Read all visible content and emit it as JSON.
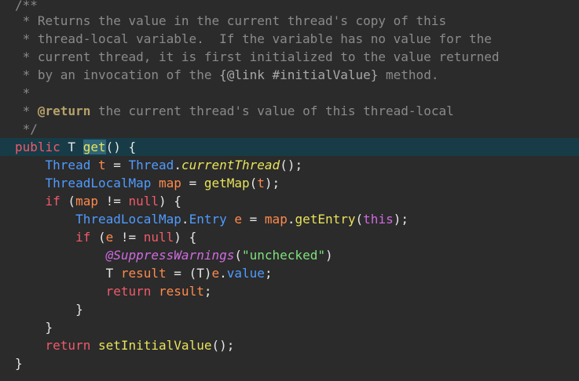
{
  "lines": [
    {
      "tokens": [
        {
          "t": "/**",
          "c": "c-comment"
        }
      ]
    },
    {
      "tokens": [
        {
          "t": " * Returns the value in the current thread's copy of this",
          "c": "c-comment"
        }
      ]
    },
    {
      "tokens": [
        {
          "t": " * thread-local variable.  If the variable has no value for the",
          "c": "c-comment"
        }
      ]
    },
    {
      "tokens": [
        {
          "t": " * current thread, it is first initialized to the value returned",
          "c": "c-comment"
        }
      ]
    },
    {
      "tokens": [
        {
          "t": " * by an invocation of the ",
          "c": "c-comment"
        },
        {
          "t": "{@link #initialValue}",
          "c": "c-link"
        },
        {
          "t": " method.",
          "c": "c-comment"
        }
      ]
    },
    {
      "tokens": [
        {
          "t": " *",
          "c": "c-comment"
        }
      ]
    },
    {
      "tokens": [
        {
          "t": " * ",
          "c": "c-comment"
        },
        {
          "t": "@return",
          "c": "c-doctag"
        },
        {
          "t": " the current thread's value of this thread-local",
          "c": "c-comment"
        }
      ]
    },
    {
      "tokens": [
        {
          "t": " */",
          "c": "c-comment"
        }
      ]
    },
    {
      "current": true,
      "tokens": [
        {
          "t": "public",
          "c": "c-keyword"
        },
        {
          "t": " T ",
          "c": "c-plain"
        },
        {
          "t": "get",
          "c": "c-method hl-word"
        },
        {
          "t": "() {",
          "c": "c-plain"
        }
      ]
    },
    {
      "tokens": [
        {
          "t": "    ",
          "c": "c-plain"
        },
        {
          "t": "Thread",
          "c": "c-type"
        },
        {
          "t": " ",
          "c": "c-plain"
        },
        {
          "t": "t",
          "c": "c-var"
        },
        {
          "t": " = ",
          "c": "c-plain"
        },
        {
          "t": "Thread",
          "c": "c-type"
        },
        {
          "t": ".",
          "c": "c-plain"
        },
        {
          "t": "currentThread",
          "c": "c-italic-method"
        },
        {
          "t": "();",
          "c": "c-plain"
        }
      ]
    },
    {
      "tokens": [
        {
          "t": "    ",
          "c": "c-plain"
        },
        {
          "t": "ThreadLocalMap",
          "c": "c-type"
        },
        {
          "t": " ",
          "c": "c-plain"
        },
        {
          "t": "map",
          "c": "c-var"
        },
        {
          "t": " = ",
          "c": "c-plain"
        },
        {
          "t": "getMap",
          "c": "c-method"
        },
        {
          "t": "(",
          "c": "c-plain"
        },
        {
          "t": "t",
          "c": "c-var"
        },
        {
          "t": ");",
          "c": "c-plain"
        }
      ]
    },
    {
      "tokens": [
        {
          "t": "    ",
          "c": "c-plain"
        },
        {
          "t": "if",
          "c": "c-keyword"
        },
        {
          "t": " (",
          "c": "c-plain"
        },
        {
          "t": "map",
          "c": "c-var"
        },
        {
          "t": " != ",
          "c": "c-plain"
        },
        {
          "t": "null",
          "c": "c-keyword"
        },
        {
          "t": ") {",
          "c": "c-plain"
        }
      ]
    },
    {
      "tokens": [
        {
          "t": "        ",
          "c": "c-plain"
        },
        {
          "t": "ThreadLocalMap",
          "c": "c-type"
        },
        {
          "t": ".",
          "c": "c-plain"
        },
        {
          "t": "Entry",
          "c": "c-type"
        },
        {
          "t": " ",
          "c": "c-plain"
        },
        {
          "t": "e",
          "c": "c-var"
        },
        {
          "t": " = ",
          "c": "c-plain"
        },
        {
          "t": "map",
          "c": "c-var"
        },
        {
          "t": ".",
          "c": "c-plain"
        },
        {
          "t": "getEntry",
          "c": "c-method"
        },
        {
          "t": "(",
          "c": "c-plain"
        },
        {
          "t": "this",
          "c": "c-this"
        },
        {
          "t": ");",
          "c": "c-plain"
        }
      ]
    },
    {
      "tokens": [
        {
          "t": "        ",
          "c": "c-plain"
        },
        {
          "t": "if",
          "c": "c-keyword"
        },
        {
          "t": " (",
          "c": "c-plain"
        },
        {
          "t": "e",
          "c": "c-var"
        },
        {
          "t": " != ",
          "c": "c-plain"
        },
        {
          "t": "null",
          "c": "c-keyword"
        },
        {
          "t": ") {",
          "c": "c-plain"
        }
      ]
    },
    {
      "tokens": [
        {
          "t": "            ",
          "c": "c-plain"
        },
        {
          "t": "@SuppressWarnings",
          "c": "c-annotation"
        },
        {
          "t": "(",
          "c": "c-plain"
        },
        {
          "t": "\"unchecked\"",
          "c": "c-string"
        },
        {
          "t": ")",
          "c": "c-plain"
        }
      ]
    },
    {
      "tokens": [
        {
          "t": "            ",
          "c": "c-plain"
        },
        {
          "t": "T",
          "c": "c-plain"
        },
        {
          "t": " ",
          "c": "c-plain"
        },
        {
          "t": "result",
          "c": "c-var"
        },
        {
          "t": " = (",
          "c": "c-plain"
        },
        {
          "t": "T",
          "c": "c-plain"
        },
        {
          "t": ")",
          "c": "c-plain"
        },
        {
          "t": "e",
          "c": "c-var"
        },
        {
          "t": ".",
          "c": "c-plain"
        },
        {
          "t": "value",
          "c": "c-field"
        },
        {
          "t": ";",
          "c": "c-plain"
        }
      ]
    },
    {
      "tokens": [
        {
          "t": "            ",
          "c": "c-plain"
        },
        {
          "t": "return",
          "c": "c-keyword"
        },
        {
          "t": " ",
          "c": "c-plain"
        },
        {
          "t": "result",
          "c": "c-var"
        },
        {
          "t": ";",
          "c": "c-plain"
        }
      ]
    },
    {
      "tokens": [
        {
          "t": "        }",
          "c": "c-plain"
        }
      ]
    },
    {
      "tokens": [
        {
          "t": "    }",
          "c": "c-plain"
        }
      ]
    },
    {
      "tokens": [
        {
          "t": "    ",
          "c": "c-plain"
        },
        {
          "t": "return",
          "c": "c-keyword"
        },
        {
          "t": " ",
          "c": "c-plain"
        },
        {
          "t": "setInitialValue",
          "c": "c-method"
        },
        {
          "t": "();",
          "c": "c-plain"
        }
      ]
    },
    {
      "tokens": [
        {
          "t": "}",
          "c": "c-plain"
        }
      ]
    }
  ]
}
